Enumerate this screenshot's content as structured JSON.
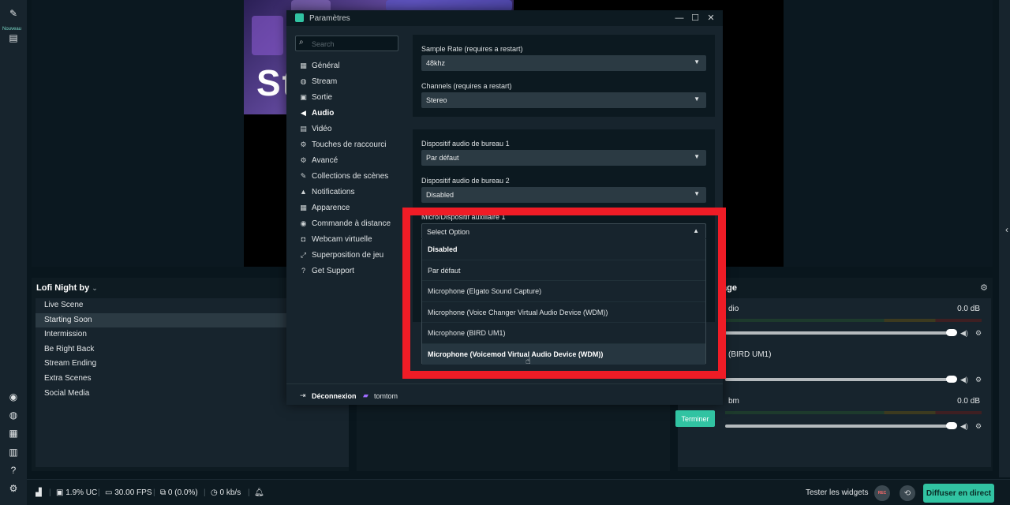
{
  "left_rail": {
    "badge": "Nouveau",
    "top_icons": [
      "wand-icon",
      "clapperboard-icon"
    ],
    "bottom_icons": [
      "help-circle-icon",
      "chat-icon",
      "apps-icon",
      "library-icon",
      "question-icon",
      "settings-icon"
    ]
  },
  "scenes": {
    "title": "Lofi Night by",
    "items": [
      "Live Scene",
      "Starting Soon",
      "Intermission",
      "Be Right Back",
      "Stream Ending",
      "Extra Scenes",
      "Social Media"
    ],
    "active_index": 1
  },
  "mixer": {
    "title": "age",
    "channels": [
      {
        "name": "dio",
        "db": "0.0 dB"
      },
      {
        "name": "(BIRD UM1)",
        "db": ""
      },
      {
        "name": "bm",
        "db": "0.0 dB"
      }
    ]
  },
  "footer": {
    "cpu": "1.9% UC",
    "fps": "30.00 FPS",
    "dropped": "0 (0.0%)",
    "bandwidth": "0 kb/s",
    "test_widgets": "Tester les widgets",
    "rec_label": "REC",
    "go_live": "Diffuser en direct"
  },
  "settings": {
    "title": "Paramètres",
    "search_placeholder": "Search",
    "nav": [
      {
        "label": "Général",
        "icon": "grid-icon"
      },
      {
        "label": "Stream",
        "icon": "globe-icon"
      },
      {
        "label": "Sortie",
        "icon": "chip-icon"
      },
      {
        "label": "Audio",
        "icon": "speaker-icon"
      },
      {
        "label": "Vidéo",
        "icon": "film-icon"
      },
      {
        "label": "Touches de raccourci",
        "icon": "gear-icon"
      },
      {
        "label": "Avancé",
        "icon": "gears-icon"
      },
      {
        "label": "Collections de scènes",
        "icon": "wand-icon"
      },
      {
        "label": "Notifications",
        "icon": "bell-icon"
      },
      {
        "label": "Apparence",
        "icon": "layout-icon"
      },
      {
        "label": "Commande à distance",
        "icon": "remote-icon"
      },
      {
        "label": "Webcam virtuelle",
        "icon": "camera-icon"
      },
      {
        "label": "Superposition de jeu",
        "icon": "expand-icon"
      },
      {
        "label": "Get Support",
        "icon": "question-icon"
      }
    ],
    "active_nav": 3,
    "fields": {
      "sample_rate_label": "Sample Rate (requires a restart)",
      "sample_rate_value": "48khz",
      "channels_label": "Channels (requires a restart)",
      "channels_value": "Stereo",
      "desktop1_label": "Dispositif audio de bureau 1",
      "desktop1_value": "Par défaut",
      "desktop2_label": "Dispositif audio de bureau 2",
      "desktop2_value": "Disabled",
      "mic_label": "Micro/Dispositif auxiliaire 1",
      "mic_value": "Select Option"
    },
    "dropdown_options": [
      "Disabled",
      "Par défaut",
      "Microphone (Elgato Sound Capture)",
      "Microphone (Voice Changer Virtual Audio Device (WDM))",
      "Microphone (BIRD UM1)",
      "Microphone (Voicemod Virtual Audio Device (WDM))"
    ],
    "logout": "Déconnexion",
    "username": "tomtom",
    "done": "Terminer"
  },
  "canvas": {
    "big_text": "St"
  },
  "colors": {
    "accent": "#31c3a2",
    "highlight": "#ef1c26",
    "background": "#09161d",
    "panel": "#17242d"
  }
}
